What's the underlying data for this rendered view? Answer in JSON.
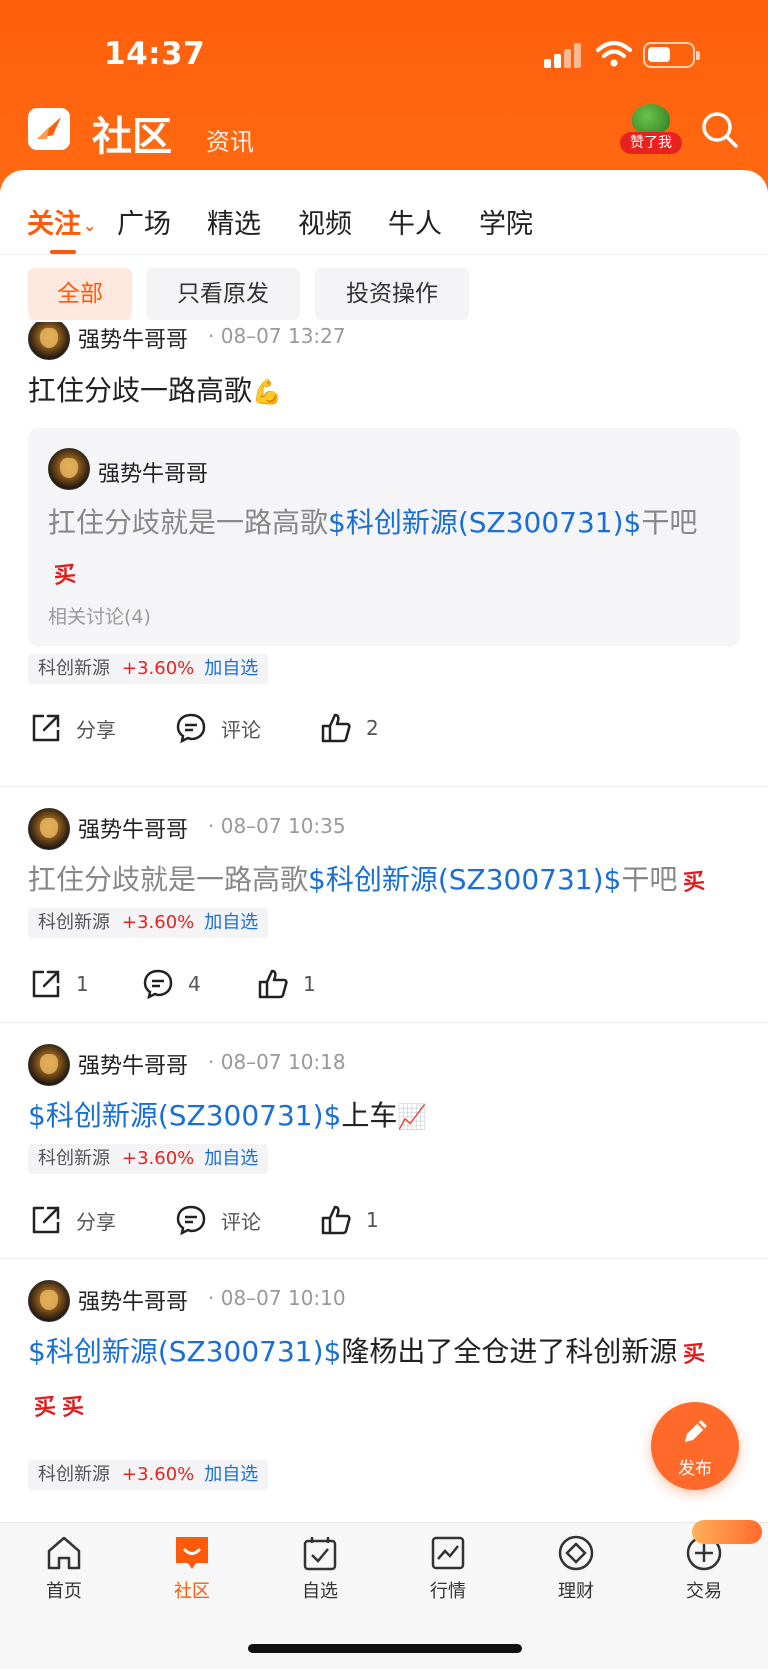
{
  "status_bar": {
    "time": "14:37"
  },
  "app_bar": {
    "title": "社区",
    "subtab": "资讯",
    "liker_badge": "赞了我"
  },
  "tabs": [
    {
      "label": "关注",
      "active": true
    },
    {
      "label": "广场"
    },
    {
      "label": "精选"
    },
    {
      "label": "视频"
    },
    {
      "label": "牛人"
    },
    {
      "label": "学院"
    }
  ],
  "filters": [
    {
      "label": "全部",
      "active": true
    },
    {
      "label": "只看原发"
    },
    {
      "label": "投资操作"
    }
  ],
  "posts": [
    {
      "author": "强势牛哥哥",
      "time": "· 08–07 13:27",
      "text": "扛住分歧一路高歌",
      "emoji": "💪",
      "quote": {
        "author": "强势牛哥哥",
        "text_before": "扛住分歧就是一路高歌",
        "link": "$科创新源(SZ300731)$",
        "text_after": "干吧",
        "buy": "买",
        "related": "相关讨论(4)"
      },
      "stock": {
        "name": "科创新源",
        "change": "+3.60%",
        "add": "加自选"
      },
      "actions": {
        "share": "分享",
        "comment": "评论",
        "likes": "2"
      }
    },
    {
      "author": "强势牛哥哥",
      "time": "· 08–07 10:35",
      "text_before": "扛住分歧就是一路高歌",
      "link": "$科创新源(SZ300731)$",
      "text_after": "干吧",
      "buy": "买",
      "stock": {
        "name": "科创新源",
        "change": "+3.60%",
        "add": "加自选"
      },
      "actions": {
        "share": "1",
        "comment": "4",
        "likes": "1"
      }
    },
    {
      "author": "强势牛哥哥",
      "time": "· 08–07 10:18",
      "link": "$科创新源(SZ300731)$",
      "text_after": "上车",
      "emoji": "📈",
      "stock": {
        "name": "科创新源",
        "change": "+3.60%",
        "add": "加自选"
      },
      "actions": {
        "share": "分享",
        "comment": "评论",
        "likes": "1"
      }
    },
    {
      "author": "强势牛哥哥",
      "time": "· 08–07 10:10",
      "link": "$科创新源(SZ300731)$",
      "text_after": "隆杨出了全仓进了科创新源",
      "buy": "买",
      "stock": {
        "name": "科创新源",
        "change": "+3.60%",
        "add": "加自选"
      }
    }
  ],
  "fab": {
    "label": "发布"
  },
  "bottom_nav": [
    {
      "label": "首页",
      "icon": "home-icon"
    },
    {
      "label": "社区",
      "icon": "community-icon",
      "active": true
    },
    {
      "label": "自选",
      "icon": "watchlist-icon"
    },
    {
      "label": "行情",
      "icon": "market-icon"
    },
    {
      "label": "理财",
      "icon": "wealth-icon"
    },
    {
      "label": "交易",
      "icon": "trade-icon"
    }
  ],
  "colors": {
    "brand": "#ff5f0a",
    "link": "#1a6fd6",
    "rise": "#e8231f"
  }
}
